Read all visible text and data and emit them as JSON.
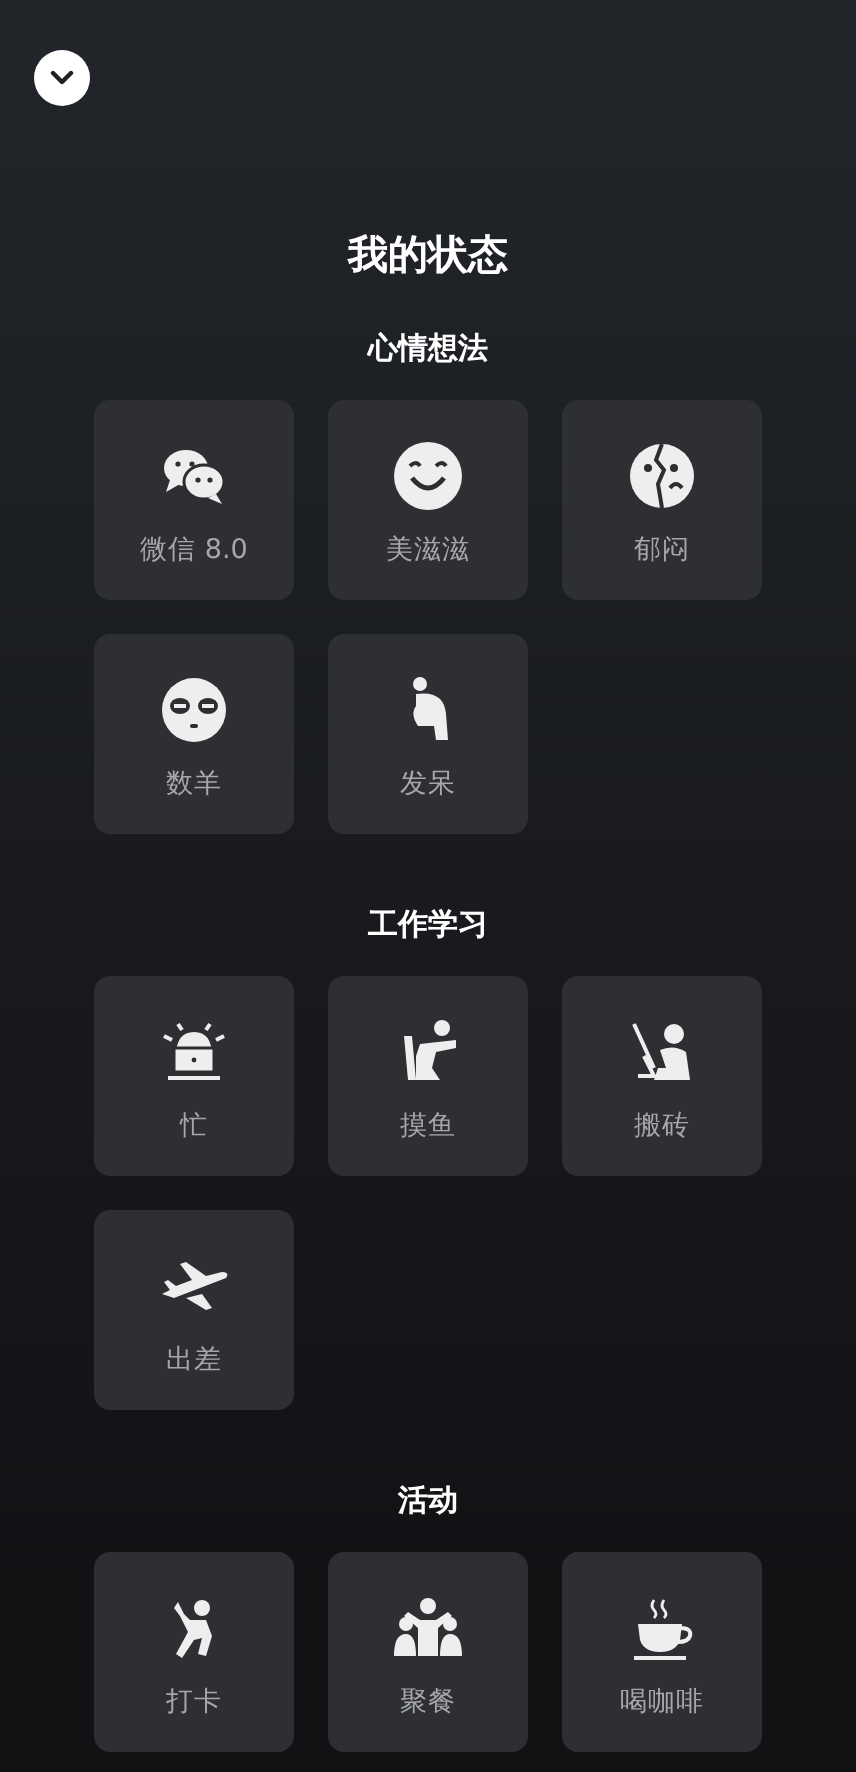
{
  "title": "我的状态",
  "sections": [
    {
      "title": "心情想法",
      "items": [
        {
          "label": "微信 8.0",
          "kind": "chat"
        },
        {
          "label": "美滋滋",
          "kind": "smile"
        },
        {
          "label": "郁闷",
          "kind": "broken"
        },
        {
          "label": "数羊",
          "kind": "sleepy"
        },
        {
          "label": "发呆",
          "kind": "thinker"
        }
      ]
    },
    {
      "title": "工作学习",
      "items": [
        {
          "label": "忙",
          "kind": "busy"
        },
        {
          "label": "摸鱼",
          "kind": "slack"
        },
        {
          "label": "搬砖",
          "kind": "brick"
        },
        {
          "label": "出差",
          "kind": "plane"
        }
      ]
    },
    {
      "title": "活动",
      "items": [
        {
          "label": "打卡",
          "kind": "checkin"
        },
        {
          "label": "聚餐",
          "kind": "party"
        },
        {
          "label": "喝咖啡",
          "kind": "coffee"
        }
      ]
    }
  ]
}
